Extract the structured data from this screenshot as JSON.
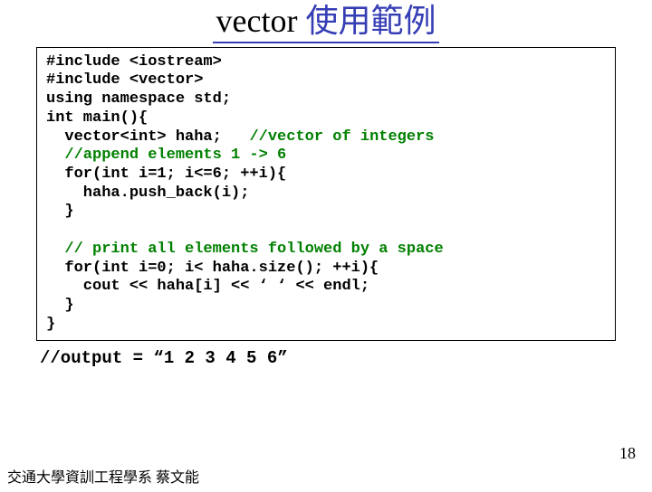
{
  "title": {
    "en": "vector",
    "zh": "使用範例"
  },
  "code": {
    "l1": "#include <iostream>",
    "l2": "#include <vector>",
    "l3": "using namespace std;",
    "l4": "int main(){",
    "l5a": "  vector<int> haha;",
    "l5b": "   //vector of integers",
    "l6": "  //append elements 1 -> 6",
    "l7": "  for(int i=1; i<=6; ++i){",
    "l8": "    haha.push_back(i);",
    "l9": "  }",
    "blank1": "",
    "l10": "  // print all elements followed by a space",
    "l11": "  for(int i=0; i< haha.size(); ++i){",
    "l12": "    cout << haha[i] << ‘ ‘ << endl;",
    "l13": "  }",
    "l14": "}"
  },
  "output": "//output = “1 2 3 4 5 6”",
  "pagenum": "18",
  "footer": "交通大學資訓工程學系 蔡文能"
}
